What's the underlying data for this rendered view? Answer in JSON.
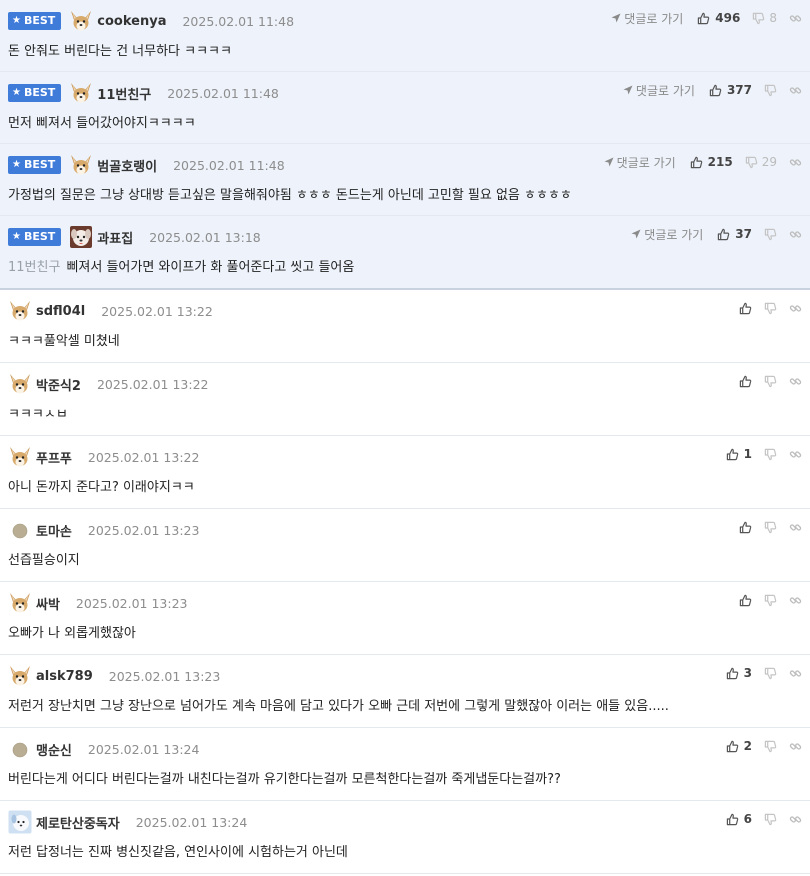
{
  "ui": {
    "best_label": "BEST",
    "goto_label": "댓글로 가기"
  },
  "comments": [
    {
      "nick": "cookenya",
      "date": "2025.02.01 11:48",
      "text": "돈 안줘도 버린다는 건 너무하다 ㅋㅋㅋㅋ",
      "reply_to": "",
      "likes": "496",
      "dislikes": "8",
      "best": true,
      "avatar": "dog"
    },
    {
      "nick": "11번친구",
      "date": "2025.02.01 11:48",
      "text": "먼저 삐져서 들어갔어야지ㅋㅋㅋㅋ",
      "reply_to": "",
      "likes": "377",
      "dislikes": "",
      "best": true,
      "avatar": "dog"
    },
    {
      "nick": "범골호랭이",
      "date": "2025.02.01 11:48",
      "text": "가정법의 질문은 그냥 상대방 듣고싶은 말을해줘야됨 ㅎㅎㅎ 돈드는게 아닌데 고민할 필요 없음 ㅎㅎㅎㅎ",
      "reply_to": "",
      "likes": "215",
      "dislikes": "29",
      "best": true,
      "avatar": "dog"
    },
    {
      "nick": "과표집",
      "date": "2025.02.01 13:18",
      "text": "삐져서 들어가면 와이프가 화 풀어준다고 씻고 들어옴",
      "reply_to": "11번친구",
      "likes": "37",
      "dislikes": "",
      "best": true,
      "avatar": "puppy"
    },
    {
      "nick": "sdfl04l",
      "date": "2025.02.01 13:22",
      "text": "ㅋㅋㅋ풀악셀 미쳤네",
      "reply_to": "",
      "likes": "",
      "dislikes": "",
      "best": false,
      "avatar": "dog"
    },
    {
      "nick": "박준식2",
      "date": "2025.02.01 13:22",
      "text": "ㅋㅋㅋㅅㅂ",
      "reply_to": "",
      "likes": "",
      "dislikes": "",
      "best": false,
      "avatar": "dog"
    },
    {
      "nick": "푸프푸",
      "date": "2025.02.01 13:22",
      "text": "아니 돈까지 준다고? 이래야지ㅋㅋ",
      "reply_to": "",
      "likes": "1",
      "dislikes": "",
      "best": false,
      "avatar": "dog"
    },
    {
      "nick": "토마손",
      "date": "2025.02.01 13:23",
      "text": "선즙필승이지",
      "reply_to": "",
      "likes": "",
      "dislikes": "",
      "best": false,
      "avatar": "dot"
    },
    {
      "nick": "싸박",
      "date": "2025.02.01 13:23",
      "text": "오빠가 나 외롭게했잖아",
      "reply_to": "",
      "likes": "",
      "dislikes": "",
      "best": false,
      "avatar": "dog"
    },
    {
      "nick": "alsk789",
      "date": "2025.02.01 13:23",
      "text": "저런거 장난치면 그냥 장난으로 넘어가도 계속 마음에 담고 있다가 오빠 근데 저번에 그렇게 말했잖아 이러는 애들 있음.....",
      "reply_to": "",
      "likes": "3",
      "dislikes": "",
      "best": false,
      "avatar": "dog"
    },
    {
      "nick": "맹순신",
      "date": "2025.02.01 13:24",
      "text": "버린다는게 어디다 버린다는걸까 내친다는걸까 유기한다는걸까 모른척한다는걸까 죽게냅둔다는걸까??",
      "reply_to": "",
      "likes": "2",
      "dislikes": "",
      "best": false,
      "avatar": "dot"
    },
    {
      "nick": "제로탄산중독자",
      "date": "2025.02.01 13:24",
      "text": "저런 답정너는 진짜 병신짓같음, 연인사이에 시험하는거 아닌데",
      "reply_to": "",
      "likes": "6",
      "dislikes": "",
      "best": false,
      "avatar": "bluedog"
    }
  ]
}
